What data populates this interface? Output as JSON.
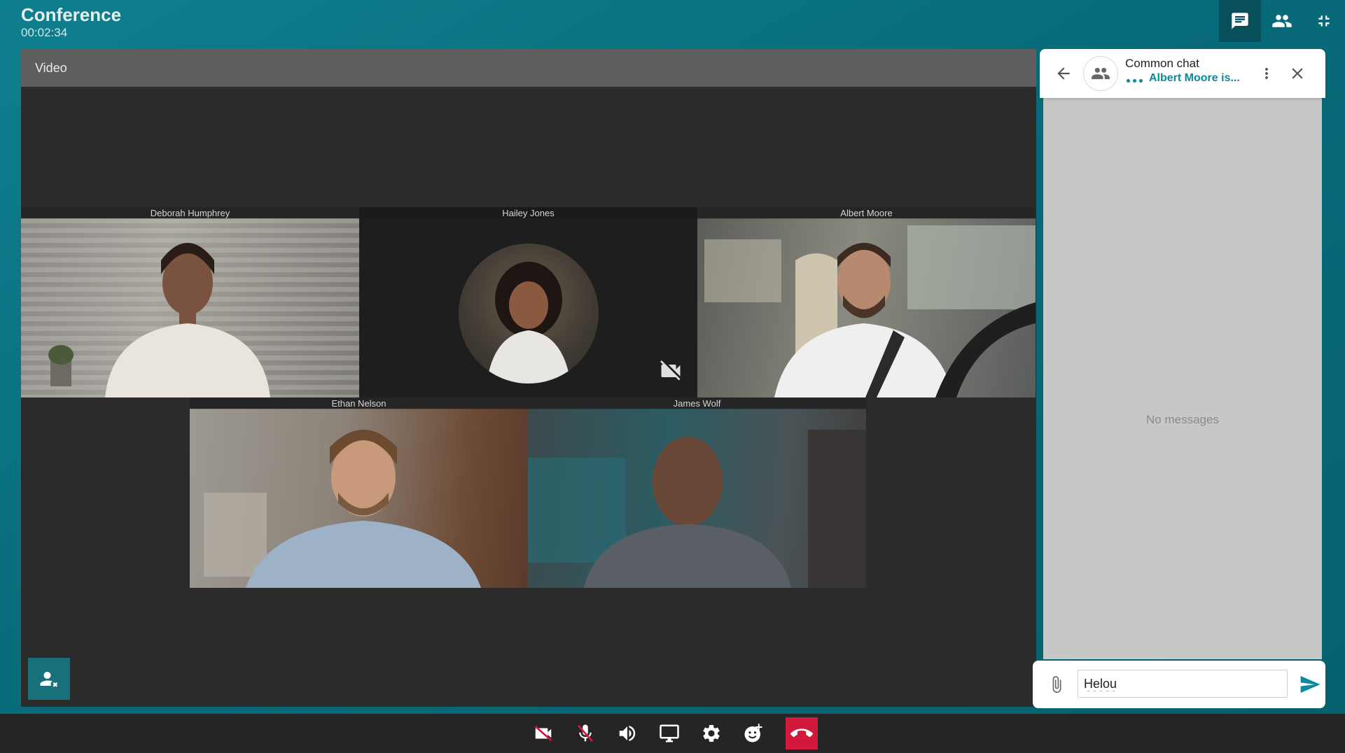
{
  "app": {
    "title": "Conference",
    "timer": "00:02:34"
  },
  "top_actions": [
    {
      "name": "chat-toggle",
      "icon": "chat-icon",
      "active": true
    },
    {
      "name": "participants",
      "icon": "people-icon",
      "active": false
    },
    {
      "name": "exit-fullscreen",
      "icon": "fullscreen-exit-icon",
      "active": false
    }
  ],
  "video": {
    "header": "Video",
    "participants": [
      {
        "name": "Deborah Humphrey",
        "camera": "on"
      },
      {
        "name": "Hailey Jones",
        "camera": "off"
      },
      {
        "name": "Albert Moore",
        "camera": "on"
      },
      {
        "name": "Ethan Nelson",
        "camera": "on"
      },
      {
        "name": "James Wolf",
        "camera": "on"
      }
    ]
  },
  "chat": {
    "title": "Common chat",
    "typing_status": "Albert Moore is...",
    "empty_text": "No messages",
    "input_value": "Helou"
  },
  "toolbar": {
    "buttons": [
      {
        "name": "camera-off",
        "icon": "video-off-icon"
      },
      {
        "name": "mic-muted",
        "icon": "mic-off-icon"
      },
      {
        "name": "speaker",
        "icon": "volume-icon"
      },
      {
        "name": "screen-share",
        "icon": "monitor-icon"
      },
      {
        "name": "settings",
        "icon": "gear-icon"
      },
      {
        "name": "reactions",
        "icon": "emoji-add-icon"
      },
      {
        "name": "hang-up",
        "icon": "phone-hangup-icon"
      }
    ]
  },
  "colors": {
    "background": "#0b7484",
    "accent": "#0a8a9a",
    "hangup": "#d1193b",
    "toolbar": "#252525"
  }
}
